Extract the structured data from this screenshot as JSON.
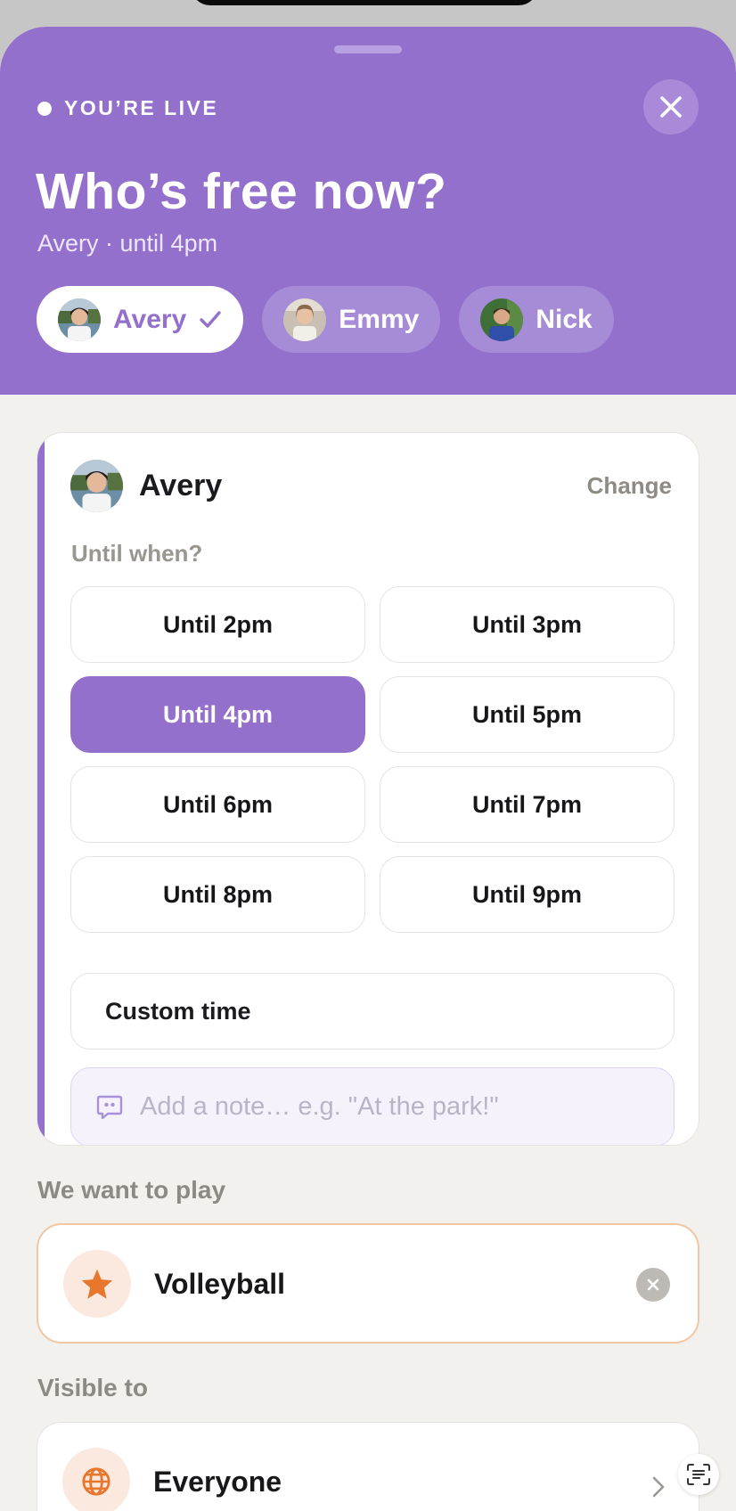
{
  "status": {
    "live_label": "YOU’RE LIVE"
  },
  "header": {
    "title": "Who’s free now?",
    "subtitle": "Avery · until 4pm"
  },
  "kids": [
    {
      "name": "Avery",
      "selected": true
    },
    {
      "name": "Emmy",
      "selected": false
    },
    {
      "name": "Nick",
      "selected": false
    }
  ],
  "card": {
    "name": "Avery",
    "change_label": "Change",
    "until_label": "Until when?",
    "options": [
      {
        "label": "Until 2pm",
        "selected": false
      },
      {
        "label": "Until 3pm",
        "selected": false
      },
      {
        "label": "Until 4pm",
        "selected": true
      },
      {
        "label": "Until 5pm",
        "selected": false
      },
      {
        "label": "Until 6pm",
        "selected": false
      },
      {
        "label": "Until 7pm",
        "selected": false
      },
      {
        "label": "Until 8pm",
        "selected": false
      },
      {
        "label": "Until 9pm",
        "selected": false
      }
    ],
    "custom_label": "Custom time",
    "note_placeholder": "Add a note… e.g. \"At the park!\"",
    "note_value": ""
  },
  "activity": {
    "section_label": "We want to play",
    "value": "Volleyball",
    "icon": "star-icon"
  },
  "visibility": {
    "section_label": "Visible to",
    "value": "Everyone",
    "icon": "globe-icon"
  },
  "colors": {
    "accent": "#9370cc",
    "orange": "#e8772e",
    "background": "#f2f1ee"
  }
}
